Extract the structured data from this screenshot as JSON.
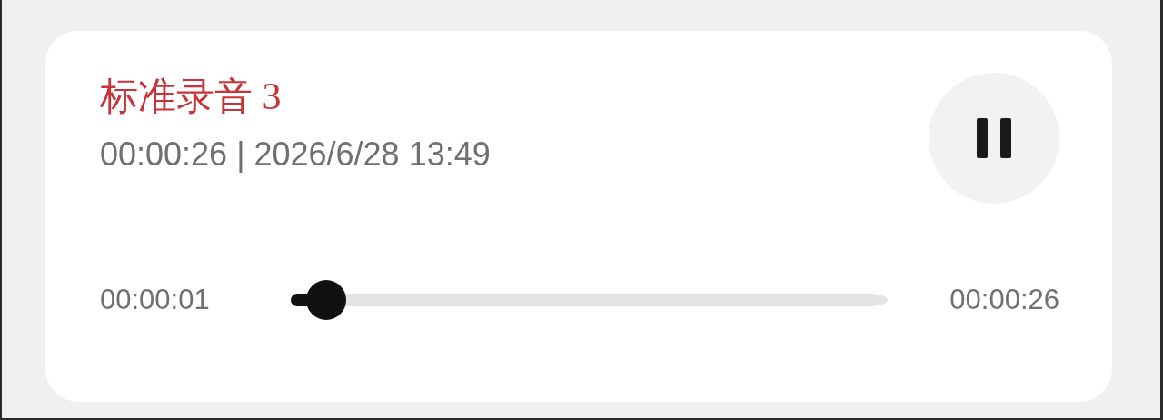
{
  "recording": {
    "title": "标准录音 3",
    "meta": "00:00:26 | 2026/6/28 13:49",
    "playing": true
  },
  "player": {
    "elapsed": "00:00:01",
    "total": "00:00:26",
    "level": 0.06
  }
}
